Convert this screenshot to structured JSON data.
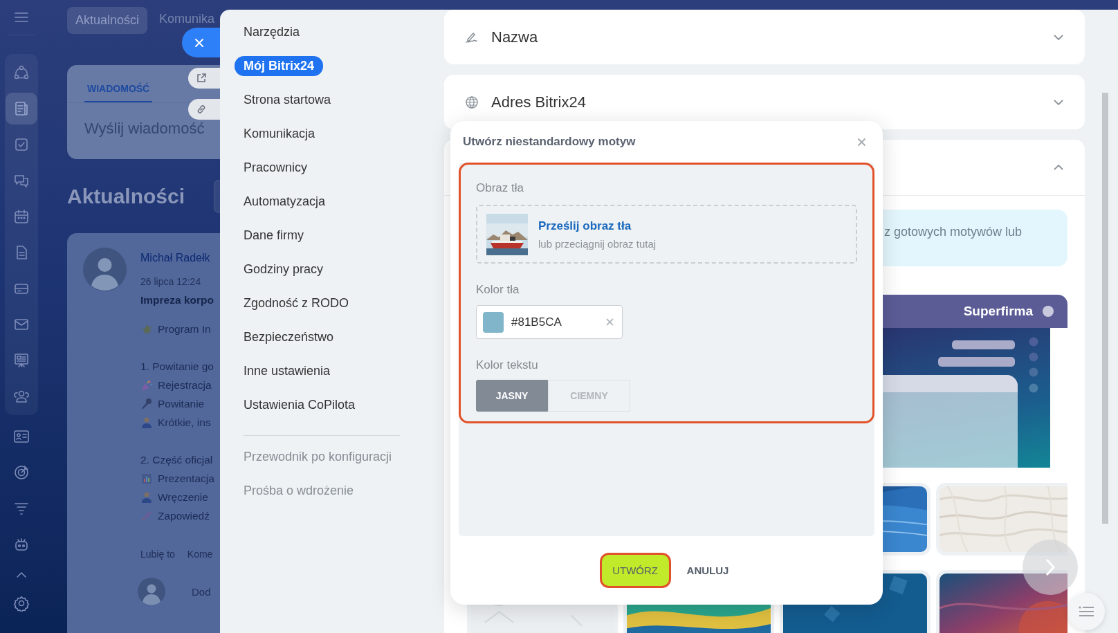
{
  "rail": {
    "items": [
      {
        "selected": false
      },
      {
        "selected": true
      },
      {
        "selected": false
      },
      {
        "selected": false
      },
      {
        "selected": false
      },
      {
        "selected": false
      },
      {
        "selected": false
      },
      {
        "selected": false
      },
      {
        "selected": false
      },
      {
        "selected": false
      },
      {
        "selected": false
      },
      {
        "selected": false
      },
      {
        "selected": false
      },
      {
        "selected": false
      }
    ]
  },
  "top_tabs": [
    {
      "label": "Aktualności",
      "selected": true
    },
    {
      "label": "Komunika",
      "selected": false
    }
  ],
  "composer": {
    "tabs": [
      {
        "label": "WIADOMOŚĆ",
        "selected": true
      }
    ],
    "placeholder": "Wyślij wiadomość"
  },
  "feed": {
    "title": "Aktualności",
    "post": {
      "author": "Michał Radełk",
      "date": "26 lipca 12:24",
      "title": "Impreza korpo",
      "lines": [
        {
          "kind": "sparkle",
          "text": "Program In"
        },
        {
          "kind": "gap"
        },
        {
          "kind": "plain",
          "text": "1. Powitanie go"
        },
        {
          "kind": "confetti",
          "text": "Rejestracja"
        },
        {
          "kind": "microphone",
          "text": "Powitanie"
        },
        {
          "kind": "person",
          "text": "Krótkie, ins"
        },
        {
          "kind": "gap"
        },
        {
          "kind": "plain",
          "text": "2. Część oficjal"
        },
        {
          "kind": "chart",
          "text": "Prezentacja"
        },
        {
          "kind": "person",
          "text": "Wręczenie"
        },
        {
          "kind": "rocket",
          "text": "Zapowiedź"
        }
      ],
      "actions": [
        "Lubię to",
        "Kome"
      ],
      "comment_placeholder": "Dod"
    }
  },
  "settings_menu": {
    "items": [
      {
        "label": "Narzędzia",
        "selected": false
      },
      {
        "label": "Mój Bitrix24",
        "selected": true
      },
      {
        "label": "Strona startowa",
        "selected": false
      },
      {
        "label": "Komunikacja",
        "selected": false
      },
      {
        "label": "Pracownicy",
        "selected": false
      },
      {
        "label": "Automatyzacja",
        "selected": false
      },
      {
        "label": "Dane firmy",
        "selected": false
      },
      {
        "label": "Godziny pracy",
        "selected": false
      },
      {
        "label": "Zgodność z RODO",
        "selected": false
      },
      {
        "label": "Bezpieczeństwo",
        "selected": false
      },
      {
        "label": "Inne ustawienia",
        "selected": false
      },
      {
        "label": "Ustawienia CoPilota",
        "selected": false
      }
    ],
    "secondary": [
      "Przewodnik po konfiguracji",
      "Prośba o wdrożenie"
    ]
  },
  "sections": [
    {
      "kind": "name",
      "title": "Nazwa",
      "expanded": false
    },
    {
      "kind": "address",
      "title": "Adres Bitrix24",
      "expanded": false
    },
    {
      "kind": "theme",
      "expanded": true,
      "info": "z gotowych motywów lub",
      "preview_title": "Superfirma"
    }
  ],
  "dialog": {
    "title": "Utwórz niestandardowy motyw",
    "form_highlighted": true,
    "background_image": {
      "label": "Obraz tła",
      "link": "Prześlij obraz tła",
      "hint": "lub przeciągnij obraz tutaj"
    },
    "background_color": {
      "label": "Kolor tła",
      "value": "#81B5CA",
      "color": "#81b5ca"
    },
    "text_color": {
      "label": "Kolor tekstu",
      "options": [
        {
          "label": "JASNY",
          "selected": true
        },
        {
          "label": "CIEMNY",
          "selected": false
        }
      ]
    },
    "buttons": [
      {
        "kind": "primary",
        "label": "UTWÓRZ",
        "highlighted": true
      },
      {
        "kind": "link",
        "label": "ANULUJ",
        "highlighted": false
      }
    ]
  }
}
